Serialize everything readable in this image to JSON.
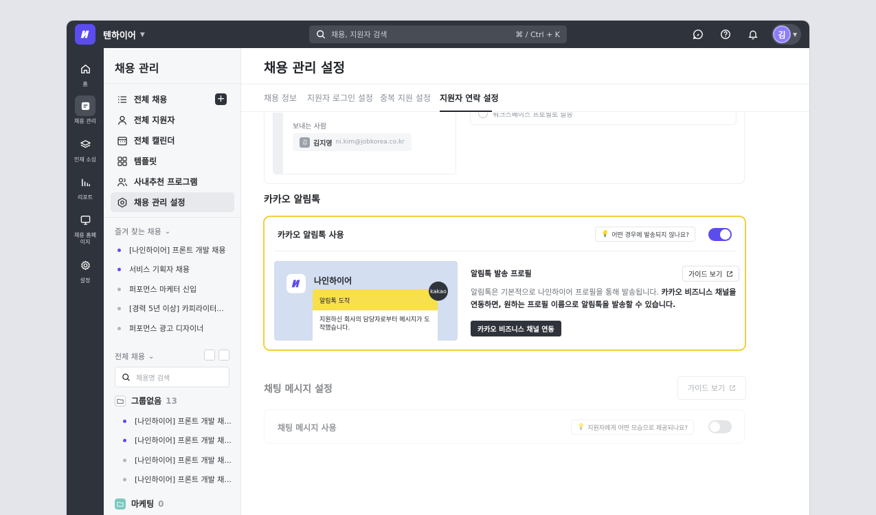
{
  "topbar": {
    "workspace": "텐하이어",
    "search_placeholder": "채용, 지원자 검색",
    "search_shortcut": "⌘ / Ctrl + K",
    "avatar_initial": "김"
  },
  "rail": [
    {
      "label": "홈",
      "icon": "home-icon"
    },
    {
      "label": "채용 관리",
      "icon": "briefcase-icon",
      "active": true
    },
    {
      "label": "인재 소싱",
      "icon": "layers-icon"
    },
    {
      "label": "리포트",
      "icon": "bar-chart-icon"
    },
    {
      "label": "채용 홈페이지",
      "icon": "monitor-icon"
    },
    {
      "label": "설정",
      "icon": "gear-icon"
    }
  ],
  "sidebar": {
    "title": "채용 관리",
    "nav": [
      {
        "label": "전체 채용",
        "icon": "list-icon"
      },
      {
        "label": "전체 지원자",
        "icon": "person-icon"
      },
      {
        "label": "전체 캘린더",
        "icon": "calendar-icon"
      },
      {
        "label": "템플릿",
        "icon": "grid-icon"
      },
      {
        "label": "사내추천 프로그램",
        "icon": "people-icon"
      },
      {
        "label": "채용 관리 설정",
        "icon": "hex-gear-icon",
        "active": true
      }
    ],
    "favorites_header": "즐겨 찾는 채용",
    "favorites": [
      {
        "label": "[나인하이어] 프론트 개발 채용",
        "color": "#5b4cf0"
      },
      {
        "label": "서비스 기획자 채용",
        "color": "#5b4cf0"
      },
      {
        "label": "퍼포먼스 마케터 신입",
        "color": "#b0b4bb"
      },
      {
        "label": "[경력 5년 이상] 카피라이터...",
        "color": "#b0b4bb"
      },
      {
        "label": "퍼포먼스 광고 디자이너",
        "color": "#b0b4bb"
      }
    ],
    "all_header": "전체 채용",
    "search_placeholder": "채용명 검색",
    "group1": {
      "label": "그룹없음",
      "count": "13"
    },
    "group1_items": [
      {
        "label": "[나인하이어] 프론트 개발 채...",
        "color": "#5b4cf0"
      },
      {
        "label": "[나인하이어] 프론트 개발 채...",
        "color": "#5b4cf0"
      },
      {
        "label": "[나인하이어] 프론트 개발 채...",
        "color": "#b0b4bb"
      },
      {
        "label": "[나인하이어] 프론트 개발 채...",
        "color": "#b0b4bb"
      }
    ],
    "group2": {
      "label": "마케팅",
      "count": "0"
    }
  },
  "main": {
    "title": "채용 관리 설정",
    "tabs": [
      "채용 정보",
      "지원자 로그인 설정",
      "중복 지원 설정",
      "지원자 연락 설정"
    ],
    "sender": {
      "label": "보내는 사람",
      "initial": "김",
      "name": "김지영",
      "email": "ni.kim@jobkorea.co.kr",
      "radio_text": "워크스페이스 프로필로 발송"
    },
    "kakao": {
      "section_title": "카카오 알림톡",
      "use_label": "카카오 알림톡 사용",
      "hint": "어떤 경우에 발송되지 않나요?",
      "toggle_on": true,
      "preview": {
        "brand": "나인하이어",
        "bubble_title": "알림톡 도착",
        "bubble_body": "지원하신 회사의 담당자로부터 메시지가 도착했습니다.",
        "kakao_badge": "kakao"
      },
      "profile_title": "알림톡 발송 프로필",
      "guide": "가이드 보기",
      "desc_normal": "알림톡은 기본적으로 나인하이어 프로필을 통해 발송됩니다. ",
      "desc_bold1": "카카오 비즈니스 채널을",
      "desc_bold2": "연동하면, 원하는 프로필 이름으로 알림톡을 발송할 수 있습니다.",
      "desc_pre2": "",
      "connect_btn": "카카오 비즈니스 채널 연동"
    },
    "chat": {
      "section_title": "채팅 메시지 설정",
      "guide": "가이드 보기",
      "use_label": "채팅 메시지 사용",
      "hint": "지원자에게 어떤 모습으로 제공되나요?",
      "toggle_on": false
    }
  },
  "colors": {
    "brand": "#5b4cf0",
    "highlight": "#f2cf3a",
    "toggle_off": "#e2e4e8"
  }
}
